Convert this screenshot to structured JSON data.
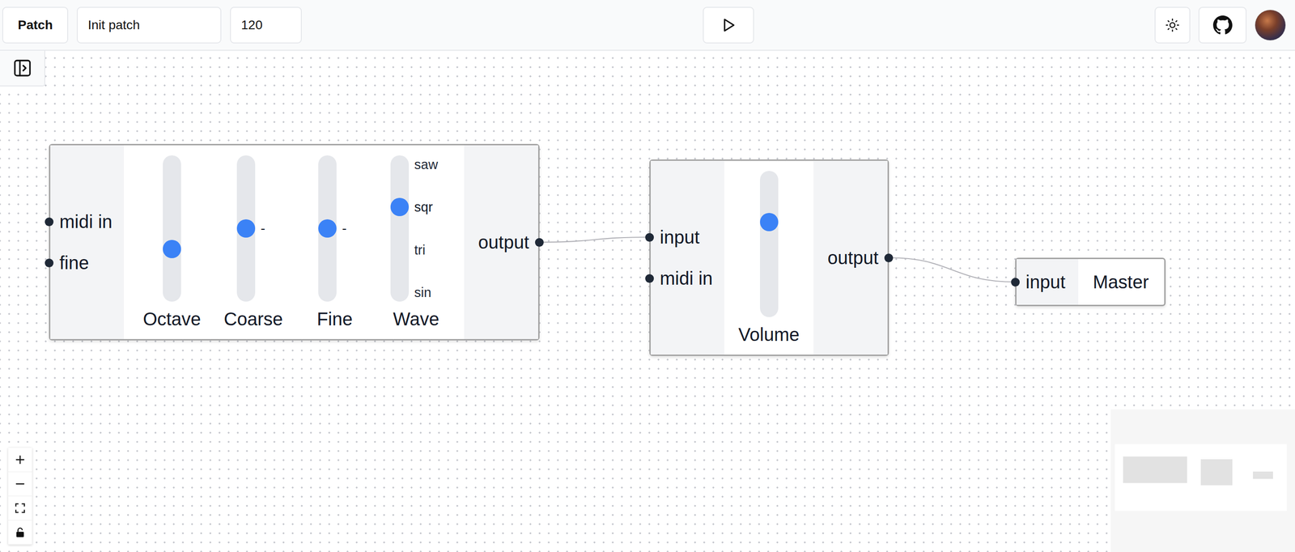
{
  "toolbar": {
    "menu": "Patch",
    "patch_name": "Init patch",
    "tempo": "120"
  },
  "nodes": [
    {
      "kind": "oscillator",
      "inputs": [
        "midi in",
        "fine"
      ],
      "controls": [
        {
          "kind": "slider",
          "label": "Octave",
          "level": 0.34
        },
        {
          "kind": "slider",
          "label": "Coarse",
          "level": 0.5,
          "reading": "-"
        },
        {
          "kind": "slider",
          "label": "Fine",
          "level": 0.5,
          "reading": "-"
        },
        {
          "kind": "selector",
          "label": "Wave",
          "options": [
            {
              "label": "saw",
              "selected": false
            },
            {
              "label": "sqr",
              "selected": true
            },
            {
              "label": "tri",
              "selected": false
            },
            {
              "label": "sin",
              "selected": false
            }
          ]
        }
      ],
      "outputs": [
        "output"
      ]
    },
    {
      "kind": "volume",
      "inputs": [
        "input",
        "midi in"
      ],
      "controls": [
        {
          "kind": "slider",
          "label": "Volume",
          "level": 0.67
        }
      ],
      "outputs": [
        "output"
      ]
    },
    {
      "kind": "master",
      "title": "Master",
      "inputs": [
        "input"
      ],
      "controls": [],
      "outputs": []
    }
  ],
  "edges": [
    {
      "from_node": 0,
      "from_port": 0,
      "to_node": 1,
      "to_port": 0
    },
    {
      "from_node": 1,
      "from_port": 0,
      "to_node": 2,
      "to_port": 0
    }
  ]
}
